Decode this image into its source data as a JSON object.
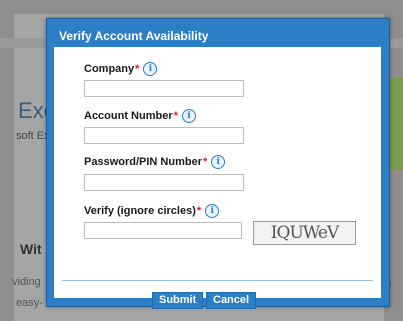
{
  "background": {
    "heading_fragment": "Exc",
    "subtext_fragment": "soft Ex",
    "section_fragment": "Wit",
    "line1_fragment": "viding",
    "line2_fragment": "easy-",
    "right_fragment": "s"
  },
  "dialog": {
    "title": "Verify Account Availability",
    "fields": [
      {
        "label": "Company",
        "required_mark": "*",
        "value": ""
      },
      {
        "label": "Account Number",
        "required_mark": "*",
        "value": ""
      },
      {
        "label": "Password/PIN Number",
        "required_mark": "*",
        "value": ""
      },
      {
        "label": "Verify (ignore circles)",
        "required_mark": "*",
        "value": ""
      }
    ],
    "info_glyph": "i",
    "captcha_text": "IQUWeV",
    "submit_label": "Submit",
    "cancel_label": "Cancel"
  },
  "colors": {
    "accent": "#2c7fc6",
    "required": "#d21f1f"
  }
}
